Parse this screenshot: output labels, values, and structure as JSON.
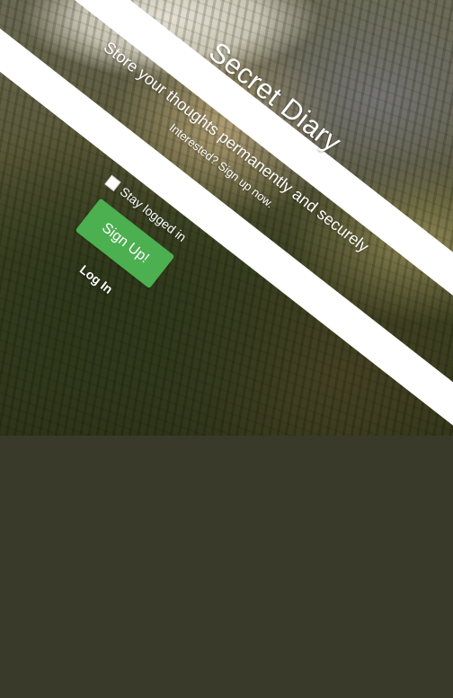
{
  "app": {
    "title": "Secret Diary",
    "tagline": "Store your thoughts permanently and securely",
    "subline": "Interested? Sign up now."
  },
  "form": {
    "stay_logged_in_label": "Stay logged in",
    "stay_logged_in_checked": false,
    "signup_button_label": "Sign Up!",
    "login_link_label": "Log In"
  },
  "colors": {
    "signup_button": "#4caf50",
    "stripe": "#ffffff",
    "text": "#ffffff"
  }
}
